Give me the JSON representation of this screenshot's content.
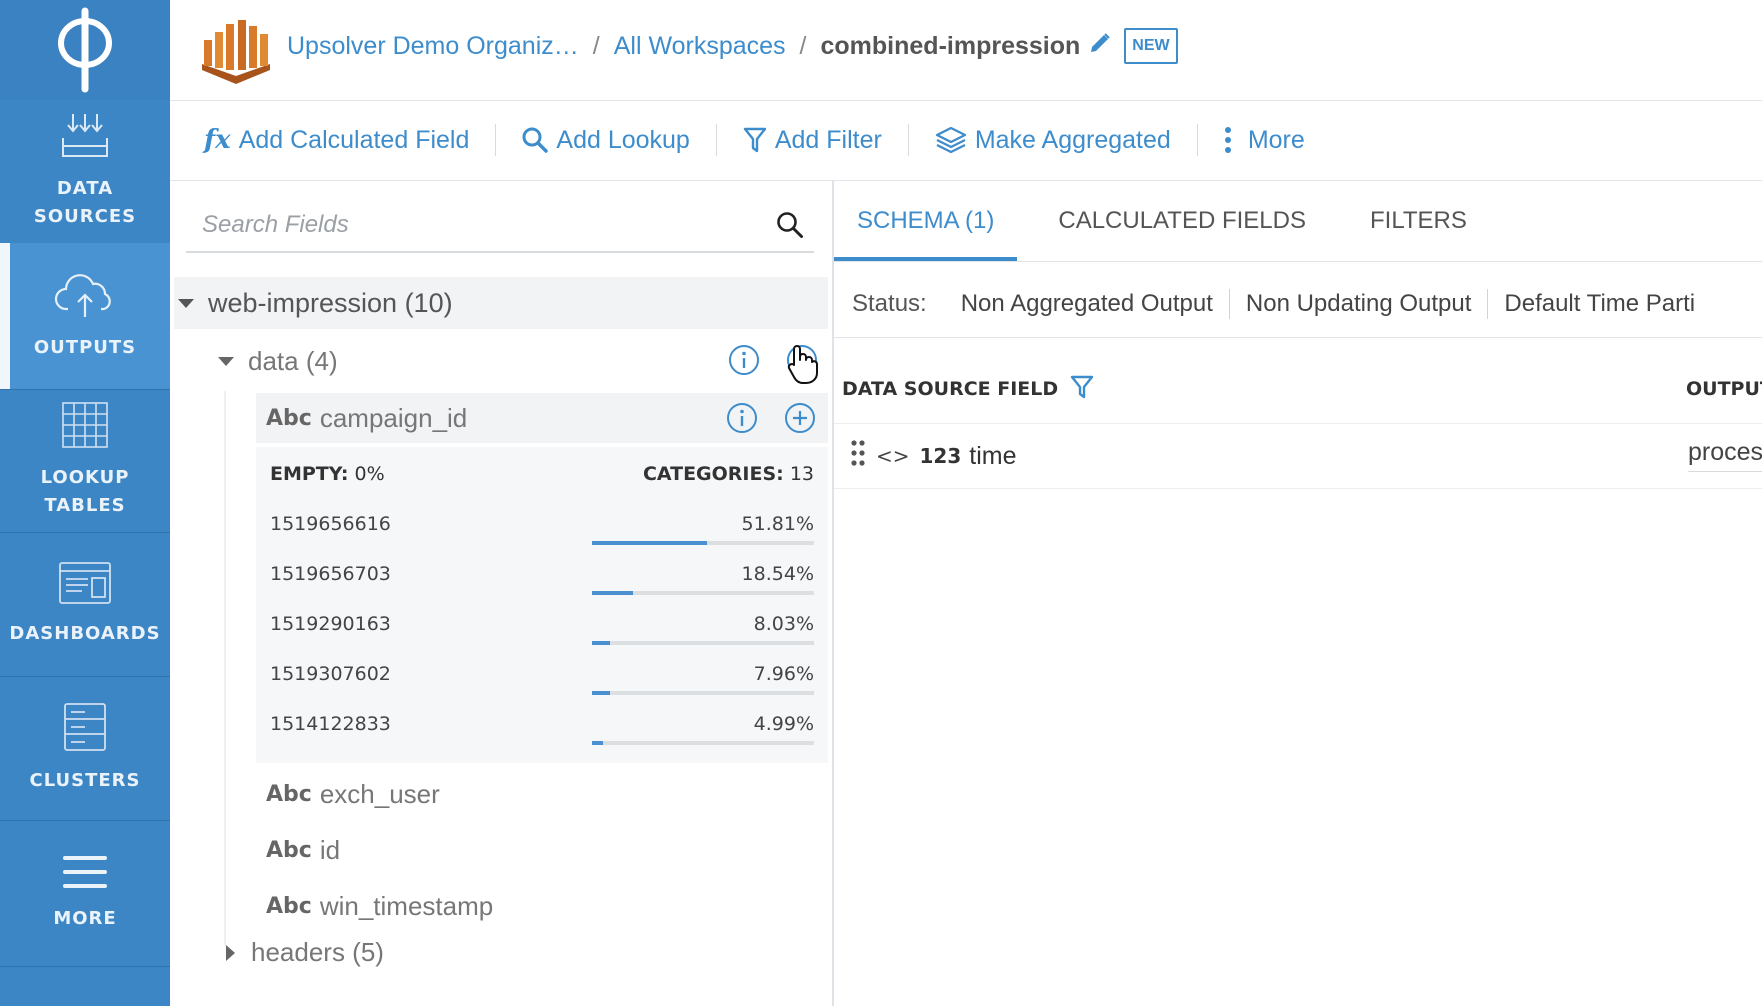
{
  "nav": {
    "items": [
      {
        "label": "DATA\nSOURCES",
        "icon": "data-sources-icon"
      },
      {
        "label": "OUTPUTS",
        "icon": "cloud-upload-icon",
        "active": true
      },
      {
        "label": "LOOKUP\nTABLES",
        "icon": "grid-table-icon"
      },
      {
        "label": "DASHBOARDS",
        "icon": "dashboard-icon"
      },
      {
        "label": "CLUSTERS",
        "icon": "server-icon"
      },
      {
        "label": "MORE",
        "icon": "hamburger-icon"
      }
    ]
  },
  "header": {
    "org": "Upsolver Demo Organiz…",
    "workspaces": "All Workspaces",
    "sep": "/",
    "output_name": "combined-impression",
    "badge": "NEW"
  },
  "toolbar": {
    "add_calculated_field": "Add Calculated Field",
    "fx": "fx",
    "add_lookup": "Add Lookup",
    "add_filter": "Add Filter",
    "make_aggregated": "Make Aggregated",
    "more": "More"
  },
  "search": {
    "placeholder": "Search Fields"
  },
  "tree": {
    "root": "web-impression (10)",
    "data": "data (4)",
    "type_label": "Abc",
    "fields": [
      "campaign_id",
      "exch_user",
      "id",
      "win_timestamp"
    ],
    "headers": "headers (5)"
  },
  "stats": {
    "empty_label": "EMPTY:",
    "empty_value": "0%",
    "categories_label": "CATEGORIES:",
    "categories_value": "13",
    "rows": [
      {
        "value": "1519656616",
        "pct": "51.81%",
        "frac": 0.5181
      },
      {
        "value": "1519656703",
        "pct": "18.54%",
        "frac": 0.1854
      },
      {
        "value": "1519290163",
        "pct": "8.03%",
        "frac": 0.0803
      },
      {
        "value": "1519307602",
        "pct": "7.96%",
        "frac": 0.0796
      },
      {
        "value": "1514122833",
        "pct": "4.99%",
        "frac": 0.0499
      }
    ]
  },
  "tabs": [
    "SCHEMA (1)",
    "CALCULATED FIELDS",
    "FILTERS"
  ],
  "status": {
    "label": "Status:",
    "items": [
      "Non Aggregated Output",
      "Non Updating Output",
      "Default Time Parti"
    ]
  },
  "schema": {
    "col_source": "DATA SOURCE FIELD",
    "col_output": "OUTPUT",
    "row": {
      "code": "<>",
      "type": "123",
      "name": "time",
      "output": "proces"
    }
  },
  "colors": {
    "nav": "#3d86c6",
    "accent": "#3d8ccc",
    "bar": "#4a8fd0"
  }
}
